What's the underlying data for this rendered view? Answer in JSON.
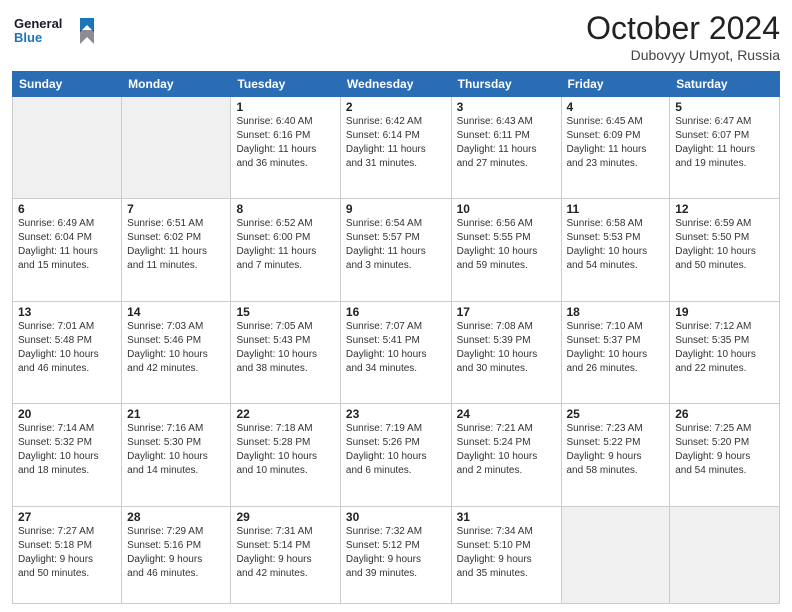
{
  "header": {
    "logo_line1": "General",
    "logo_line2": "Blue",
    "month": "October 2024",
    "location": "Dubovyy Umyot, Russia"
  },
  "days_of_week": [
    "Sunday",
    "Monday",
    "Tuesday",
    "Wednesday",
    "Thursday",
    "Friday",
    "Saturday"
  ],
  "weeks": [
    [
      {
        "day": "",
        "info": ""
      },
      {
        "day": "",
        "info": ""
      },
      {
        "day": "1",
        "info": "Sunrise: 6:40 AM\nSunset: 6:16 PM\nDaylight: 11 hours\nand 36 minutes."
      },
      {
        "day": "2",
        "info": "Sunrise: 6:42 AM\nSunset: 6:14 PM\nDaylight: 11 hours\nand 31 minutes."
      },
      {
        "day": "3",
        "info": "Sunrise: 6:43 AM\nSunset: 6:11 PM\nDaylight: 11 hours\nand 27 minutes."
      },
      {
        "day": "4",
        "info": "Sunrise: 6:45 AM\nSunset: 6:09 PM\nDaylight: 11 hours\nand 23 minutes."
      },
      {
        "day": "5",
        "info": "Sunrise: 6:47 AM\nSunset: 6:07 PM\nDaylight: 11 hours\nand 19 minutes."
      }
    ],
    [
      {
        "day": "6",
        "info": "Sunrise: 6:49 AM\nSunset: 6:04 PM\nDaylight: 11 hours\nand 15 minutes."
      },
      {
        "day": "7",
        "info": "Sunrise: 6:51 AM\nSunset: 6:02 PM\nDaylight: 11 hours\nand 11 minutes."
      },
      {
        "day": "8",
        "info": "Sunrise: 6:52 AM\nSunset: 6:00 PM\nDaylight: 11 hours\nand 7 minutes."
      },
      {
        "day": "9",
        "info": "Sunrise: 6:54 AM\nSunset: 5:57 PM\nDaylight: 11 hours\nand 3 minutes."
      },
      {
        "day": "10",
        "info": "Sunrise: 6:56 AM\nSunset: 5:55 PM\nDaylight: 10 hours\nand 59 minutes."
      },
      {
        "day": "11",
        "info": "Sunrise: 6:58 AM\nSunset: 5:53 PM\nDaylight: 10 hours\nand 54 minutes."
      },
      {
        "day": "12",
        "info": "Sunrise: 6:59 AM\nSunset: 5:50 PM\nDaylight: 10 hours\nand 50 minutes."
      }
    ],
    [
      {
        "day": "13",
        "info": "Sunrise: 7:01 AM\nSunset: 5:48 PM\nDaylight: 10 hours\nand 46 minutes."
      },
      {
        "day": "14",
        "info": "Sunrise: 7:03 AM\nSunset: 5:46 PM\nDaylight: 10 hours\nand 42 minutes."
      },
      {
        "day": "15",
        "info": "Sunrise: 7:05 AM\nSunset: 5:43 PM\nDaylight: 10 hours\nand 38 minutes."
      },
      {
        "day": "16",
        "info": "Sunrise: 7:07 AM\nSunset: 5:41 PM\nDaylight: 10 hours\nand 34 minutes."
      },
      {
        "day": "17",
        "info": "Sunrise: 7:08 AM\nSunset: 5:39 PM\nDaylight: 10 hours\nand 30 minutes."
      },
      {
        "day": "18",
        "info": "Sunrise: 7:10 AM\nSunset: 5:37 PM\nDaylight: 10 hours\nand 26 minutes."
      },
      {
        "day": "19",
        "info": "Sunrise: 7:12 AM\nSunset: 5:35 PM\nDaylight: 10 hours\nand 22 minutes."
      }
    ],
    [
      {
        "day": "20",
        "info": "Sunrise: 7:14 AM\nSunset: 5:32 PM\nDaylight: 10 hours\nand 18 minutes."
      },
      {
        "day": "21",
        "info": "Sunrise: 7:16 AM\nSunset: 5:30 PM\nDaylight: 10 hours\nand 14 minutes."
      },
      {
        "day": "22",
        "info": "Sunrise: 7:18 AM\nSunset: 5:28 PM\nDaylight: 10 hours\nand 10 minutes."
      },
      {
        "day": "23",
        "info": "Sunrise: 7:19 AM\nSunset: 5:26 PM\nDaylight: 10 hours\nand 6 minutes."
      },
      {
        "day": "24",
        "info": "Sunrise: 7:21 AM\nSunset: 5:24 PM\nDaylight: 10 hours\nand 2 minutes."
      },
      {
        "day": "25",
        "info": "Sunrise: 7:23 AM\nSunset: 5:22 PM\nDaylight: 9 hours\nand 58 minutes."
      },
      {
        "day": "26",
        "info": "Sunrise: 7:25 AM\nSunset: 5:20 PM\nDaylight: 9 hours\nand 54 minutes."
      }
    ],
    [
      {
        "day": "27",
        "info": "Sunrise: 7:27 AM\nSunset: 5:18 PM\nDaylight: 9 hours\nand 50 minutes."
      },
      {
        "day": "28",
        "info": "Sunrise: 7:29 AM\nSunset: 5:16 PM\nDaylight: 9 hours\nand 46 minutes."
      },
      {
        "day": "29",
        "info": "Sunrise: 7:31 AM\nSunset: 5:14 PM\nDaylight: 9 hours\nand 42 minutes."
      },
      {
        "day": "30",
        "info": "Sunrise: 7:32 AM\nSunset: 5:12 PM\nDaylight: 9 hours\nand 39 minutes."
      },
      {
        "day": "31",
        "info": "Sunrise: 7:34 AM\nSunset: 5:10 PM\nDaylight: 9 hours\nand 35 minutes."
      },
      {
        "day": "",
        "info": ""
      },
      {
        "day": "",
        "info": ""
      }
    ]
  ]
}
